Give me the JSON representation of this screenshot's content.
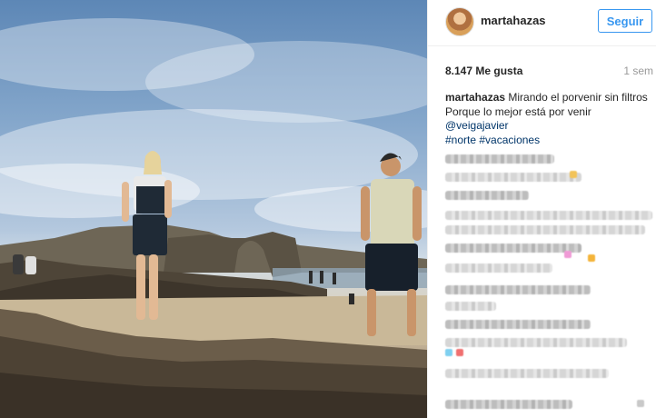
{
  "post": {
    "username": "martahazas",
    "follow_label": "Seguir",
    "likes": "8.147 Me gusta",
    "time_ago": "1 sem",
    "caption_user": "martahazas",
    "caption_line1": "Mirando el porvenir sin filtros",
    "caption_line2": "Porque lo mejor está por venir",
    "mention": "@veigajavier",
    "hashtag1": "#norte",
    "hashtag2": "#vacaciones"
  },
  "colors": {
    "accent": "#3897f0",
    "link": "#003569"
  },
  "icons": {
    "avatar": "profile-photo"
  }
}
